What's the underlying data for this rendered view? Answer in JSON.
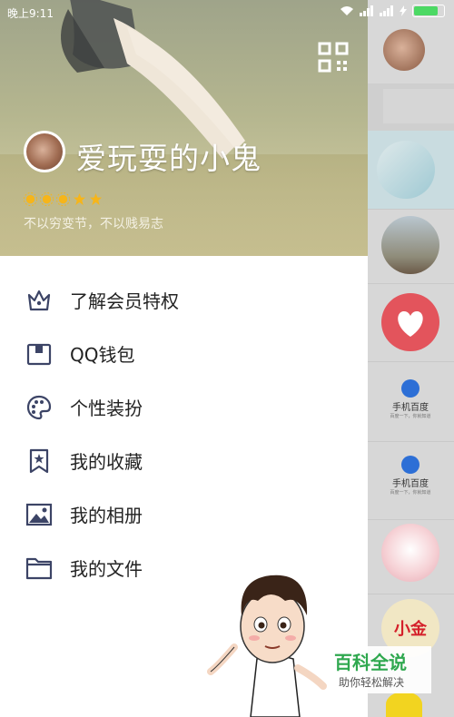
{
  "status_bar": {
    "time": "晚上9:11",
    "battery_color": "#4cd964"
  },
  "profile": {
    "nickname": "爱玩耍的小鬼",
    "signature": "不以穷变节，不以贱易志",
    "level_stars": 5,
    "qr_icon": "qr-code-icon"
  },
  "menu": {
    "items": [
      {
        "label": "了解会员特权",
        "icon": "crown-icon"
      },
      {
        "label": "QQ钱包",
        "icon": "wallet-icon"
      },
      {
        "label": "个性装扮",
        "icon": "palette-icon"
      },
      {
        "label": "我的收藏",
        "icon": "bookmark-star-icon"
      },
      {
        "label": "我的相册",
        "icon": "photo-icon"
      },
      {
        "label": "我的文件",
        "icon": "folder-icon"
      }
    ],
    "icon_color": "#3c4466"
  },
  "right_pane": {
    "baidu_title": "手机百度",
    "baidu_subtitle": "百度一下，你就知道",
    "heart_color": "#e3545c",
    "sticker_text": "小金"
  },
  "watermark": {
    "title": "百科全说",
    "subtitle": "助你轻松解决"
  }
}
